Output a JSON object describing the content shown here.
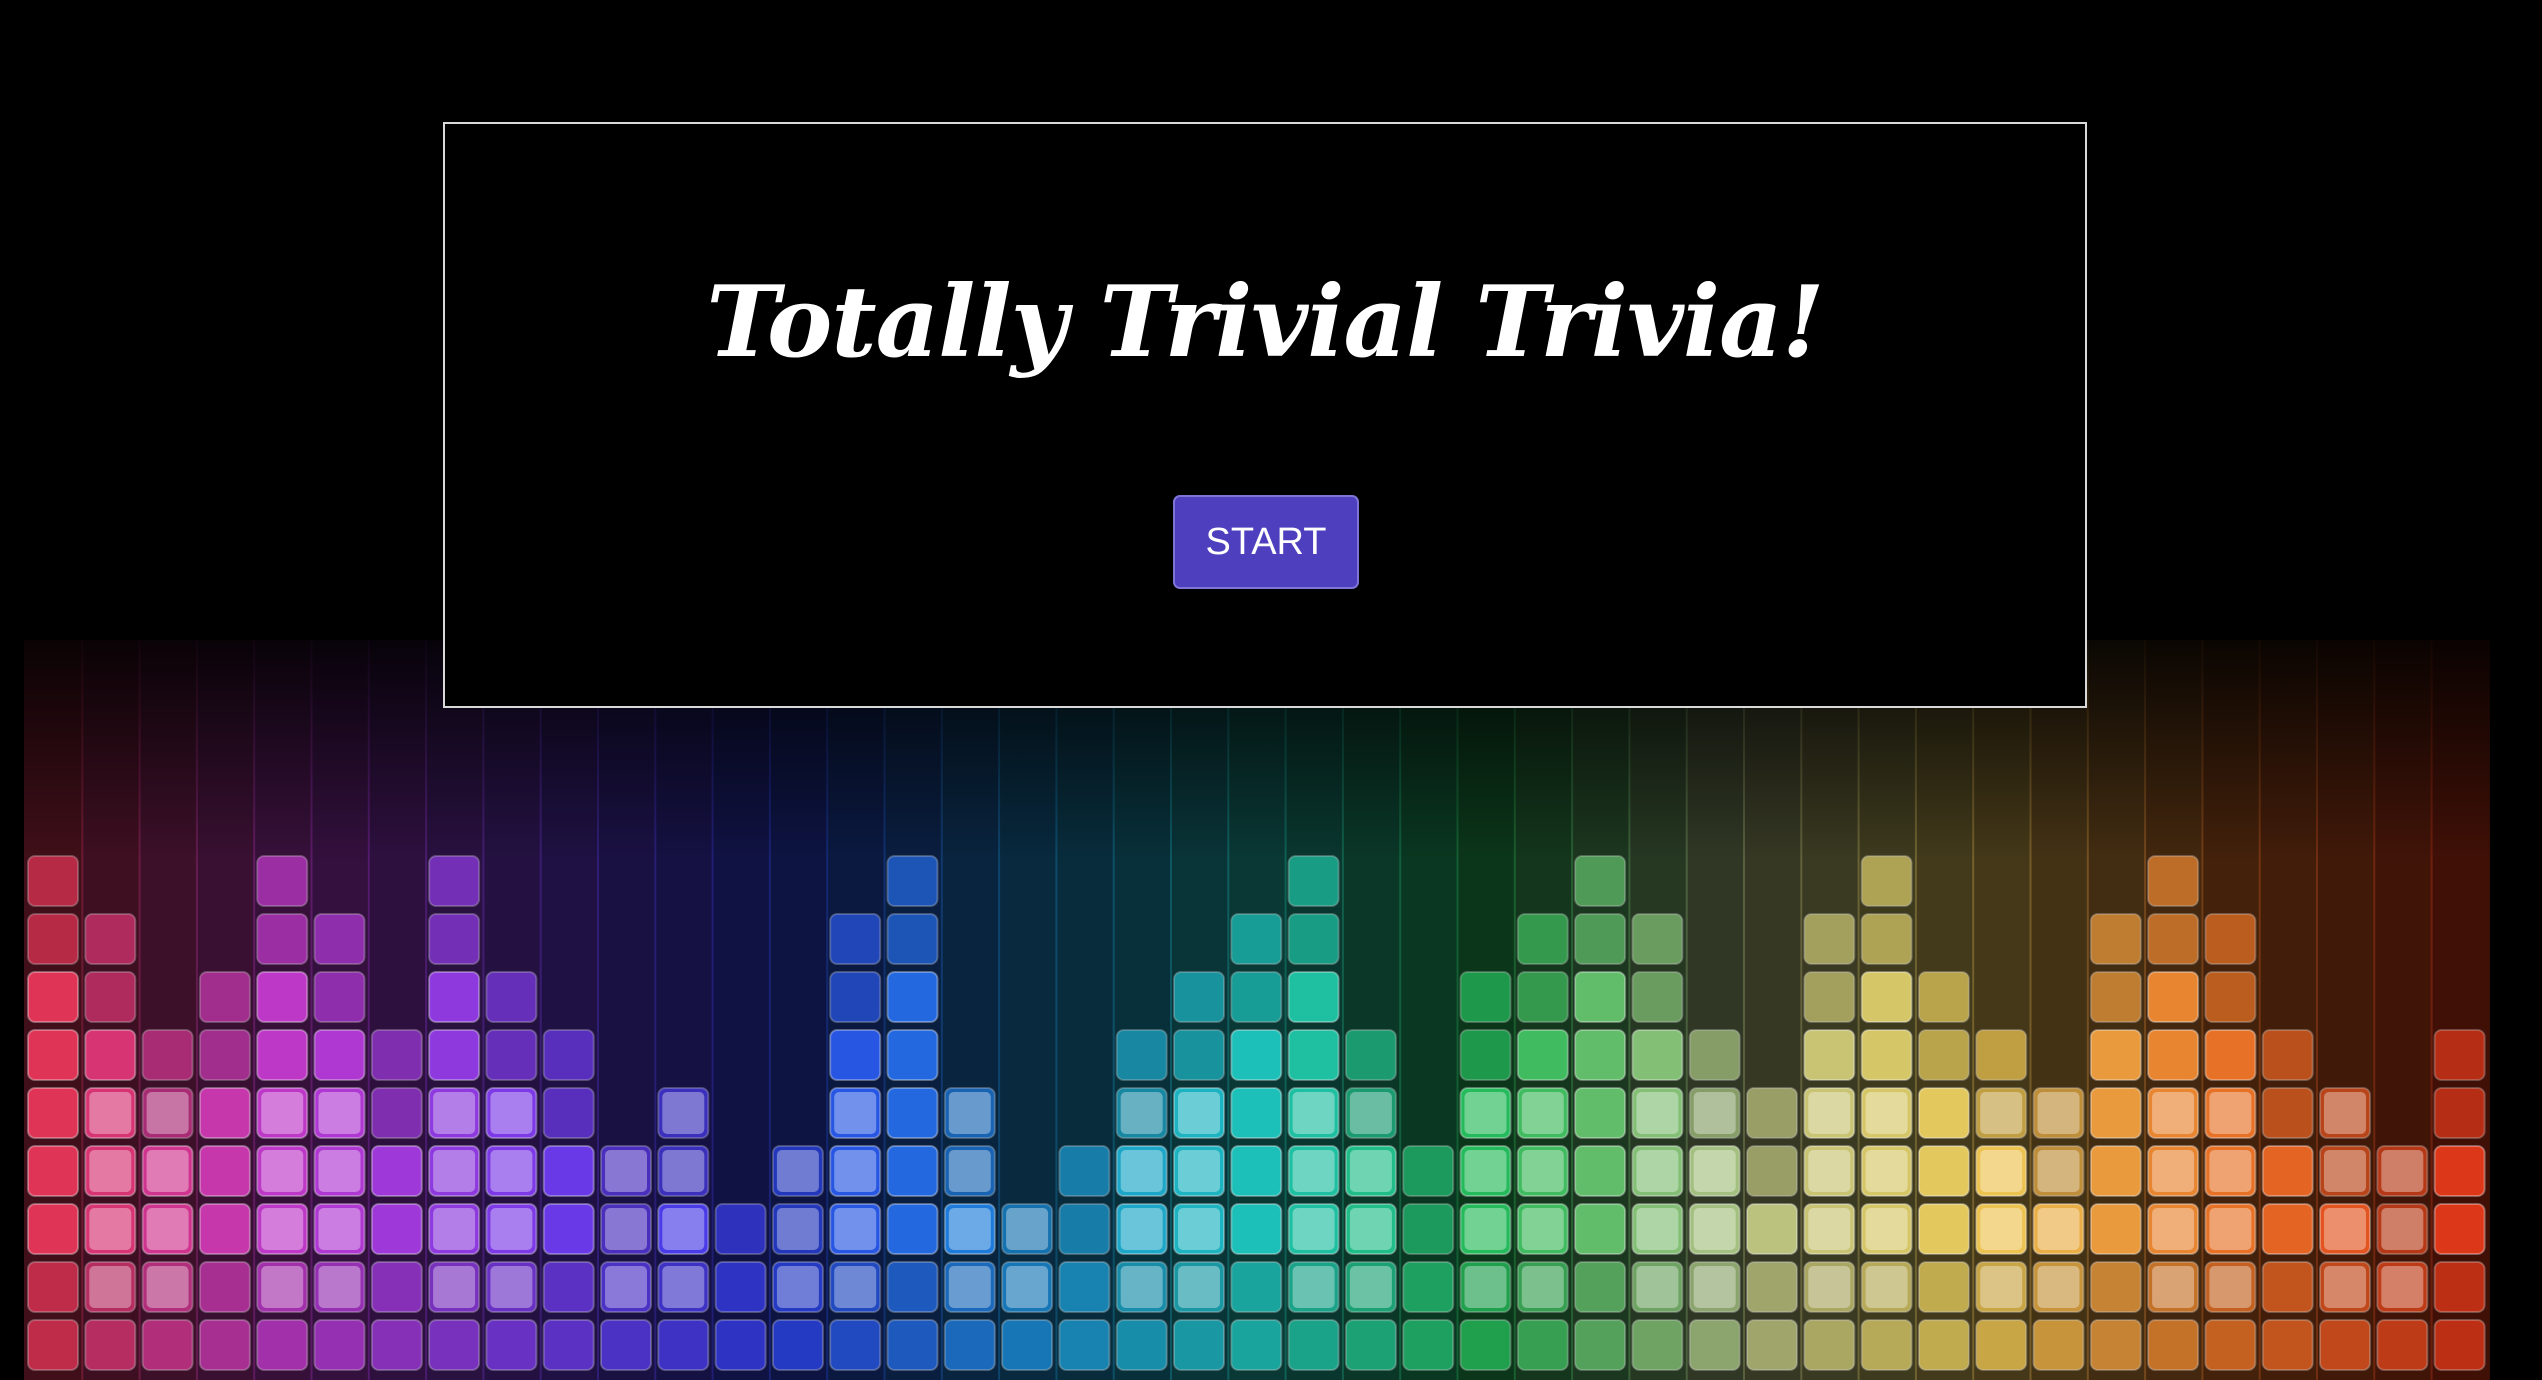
{
  "title": "Totally Trivial Trivia!",
  "start_button_label": "START",
  "colors": {
    "background": "#000000",
    "card_border": "#d9d9d9",
    "button_fill": "#4d3fbd",
    "title_text": "#ffffff"
  },
  "background_art": {
    "icon": "rainbow-equalizer-bars-image",
    "palette": [
      "#e8365a",
      "#c43bd6",
      "#7a3cf0",
      "#2f3ff0",
      "#1d8fe0",
      "#1fc8c0",
      "#27c25a",
      "#b9c98a",
      "#f5d25a",
      "#f07a2a",
      "#e63a1a"
    ]
  }
}
